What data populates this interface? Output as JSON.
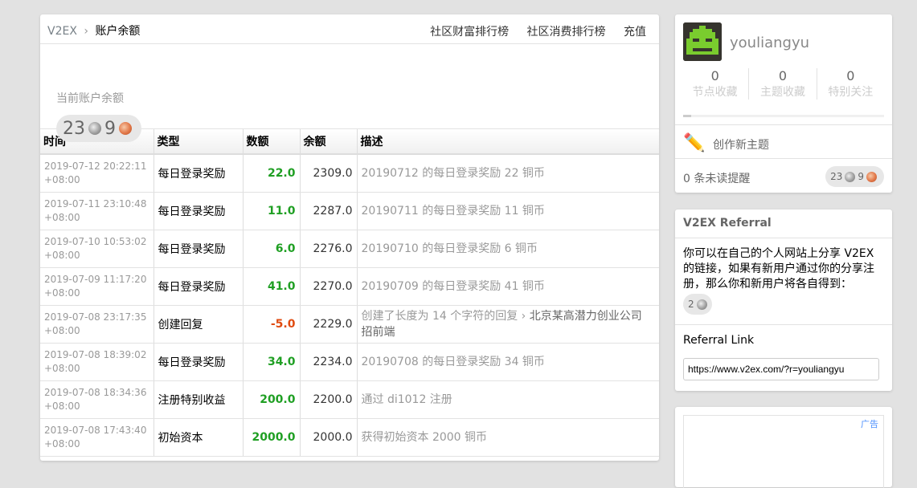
{
  "breadcrumb": {
    "site": "V2EX",
    "separator": "›",
    "current": "账户余额"
  },
  "topnav": [
    "社区财富排行榜",
    "社区消费排行榜",
    "充值"
  ],
  "balance": {
    "label": "当前账户余额",
    "silver": "23",
    "bronze": "9"
  },
  "table": {
    "headers": [
      "时间",
      "类型",
      "数额",
      "余额",
      "描述"
    ],
    "rows": [
      {
        "time1": "2019-07-12 20:22:11",
        "time2": "+08:00",
        "type": "每日登录奖励",
        "amount": "22.0",
        "amount_sign": "pos",
        "balance": "2309.0",
        "desc": "20190712 的每日登录奖励 22 铜币",
        "desc_link": ""
      },
      {
        "time1": "2019-07-11 23:10:48",
        "time2": "+08:00",
        "type": "每日登录奖励",
        "amount": "11.0",
        "amount_sign": "pos",
        "balance": "2287.0",
        "desc": "20190711 的每日登录奖励 11 铜币",
        "desc_link": ""
      },
      {
        "time1": "2019-07-10 10:53:02",
        "time2": "+08:00",
        "type": "每日登录奖励",
        "amount": "6.0",
        "amount_sign": "pos",
        "balance": "2276.0",
        "desc": "20190710 的每日登录奖励 6 铜币",
        "desc_link": ""
      },
      {
        "time1": "2019-07-09 11:17:20",
        "time2": "+08:00",
        "type": "每日登录奖励",
        "amount": "41.0",
        "amount_sign": "pos",
        "balance": "2270.0",
        "desc": "20190709 的每日登录奖励 41 铜币",
        "desc_link": ""
      },
      {
        "time1": "2019-07-08 23:17:35",
        "time2": "+08:00",
        "type": "创建回复",
        "amount": "-5.0",
        "amount_sign": "neg",
        "balance": "2229.0",
        "desc": "创建了长度为 14 个字符的回复 › ",
        "desc_link": "北京某高潜力创业公司 招前端"
      },
      {
        "time1": "2019-07-08 18:39:02",
        "time2": "+08:00",
        "type": "每日登录奖励",
        "amount": "34.0",
        "amount_sign": "pos",
        "balance": "2234.0",
        "desc": "20190708 的每日登录奖励 34 铜币",
        "desc_link": ""
      },
      {
        "time1": "2019-07-08 18:34:36",
        "time2": "+08:00",
        "type": "注册特别收益",
        "amount": "200.0",
        "amount_sign": "pos",
        "balance": "2200.0",
        "desc": "通过 di1012 注册",
        "desc_link": ""
      },
      {
        "time1": "2019-07-08 17:43:40",
        "time2": "+08:00",
        "type": "初始资本",
        "amount": "2000.0",
        "amount_sign": "pos",
        "balance": "2000.0",
        "desc": "获得初始资本 2000 铜币",
        "desc_link": ""
      }
    ]
  },
  "user": {
    "name": "youliangyu",
    "stats": [
      {
        "n": "0",
        "label": "节点收藏"
      },
      {
        "n": "0",
        "label": "主题收藏"
      },
      {
        "n": "0",
        "label": "特别关注"
      }
    ],
    "progress": 0.04,
    "new_topic": "创作新主题",
    "notifications": "0 条未读提醒",
    "silver": "23",
    "bronze": "9"
  },
  "referral": {
    "title": "V2EX Referral",
    "desc": "你可以在自己的个人网站上分享 V2EX 的链接，如果有新用户通过你的分享注册，那么你和新用户将各自得到：",
    "reward": "2",
    "link_label": "Referral Link",
    "link": "https://www.v2ex.com/?r=youliangyu"
  },
  "ad": {
    "label": "广告"
  },
  "colors": {
    "positive": "#1f9f23",
    "negative": "#e04b10"
  },
  "icons": {
    "silver_coin": "silver-coin-icon",
    "bronze_coin": "bronze-coin-icon",
    "pencil": "pencil-icon"
  }
}
